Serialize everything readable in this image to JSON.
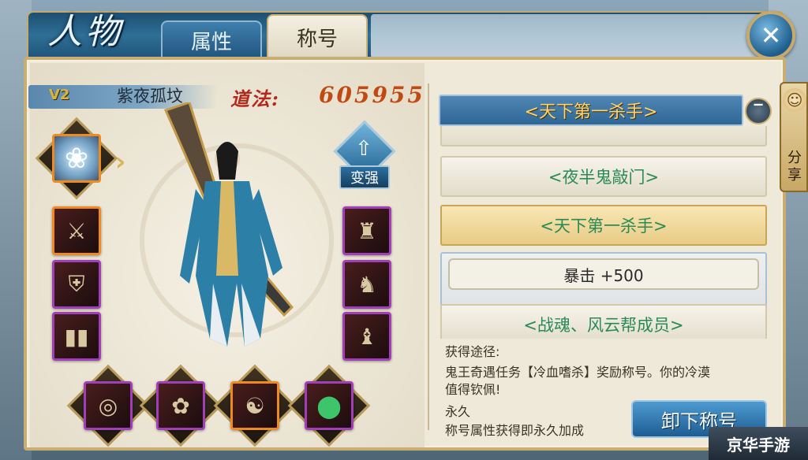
{
  "header": {
    "title": "人物",
    "tabs": [
      {
        "label": "属性",
        "active": false
      },
      {
        "label": "称号",
        "active": true
      }
    ],
    "close_icon": "close-icon"
  },
  "character": {
    "vip": "V2",
    "name": "紫夜孤坟",
    "daofa_label": "道法:",
    "daofa_value": "605955",
    "upgrade_label": "变强"
  },
  "equipment": {
    "lotus_icon": "lotus-icon",
    "left_slots": [
      "sword-icon",
      "armor-icon",
      "boots-icon"
    ],
    "right_slots": [
      "helmet-icon",
      "robe-icon",
      "belt-icon"
    ],
    "bottom_slots": [
      "ring-icon",
      "necklace-icon",
      "pendant-icon",
      "jade-icon"
    ]
  },
  "titles": {
    "selected": "<天下第一杀手>",
    "list": [
      {
        "label": "<夜半鬼敲门>",
        "state": "normal"
      },
      {
        "label": "<天下第一杀手>",
        "state": "active"
      },
      {
        "label": "暴击 +500",
        "state": "attribute"
      },
      {
        "label": "<战魂、风云帮成员>",
        "state": "normal"
      }
    ]
  },
  "description": {
    "source_label": "获得途径:",
    "source_text_line1": "鬼王奇遇任务【冷血嗜杀】奖励称号。你的冷漠",
    "source_text_line2": "值得钦佩!",
    "duration": "永久",
    "duration_note": "称号属性获得即永久加成"
  },
  "buttons": {
    "unload": "卸下称号"
  },
  "share": {
    "label": "分享"
  },
  "watermark": "京华手游",
  "colors": {
    "accent_blue": "#2e6796",
    "title_green": "#2a8a55",
    "daofa_red": "#c04a12",
    "selected_gold": "#ffd46a"
  }
}
